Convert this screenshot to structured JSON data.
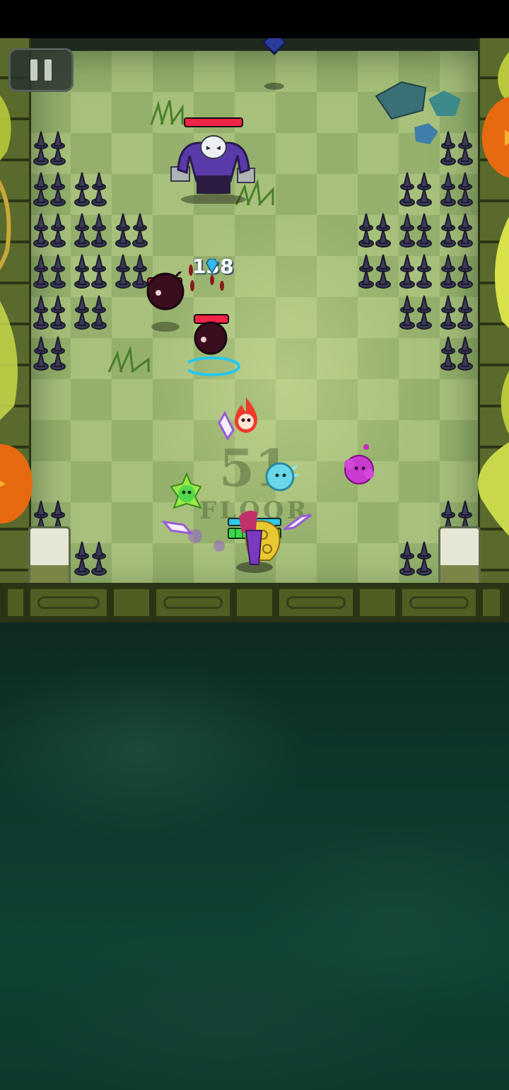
{
  "hud": {
    "pause_icon": "pause-icon"
  },
  "combat": {
    "damage_number": "138",
    "damage_icon": "diamond-gem-icon"
  },
  "level": {
    "floor_number": "51",
    "floor_word": "FLOOR"
  },
  "boss": {
    "icon": "skull-brute-icon",
    "hp_fraction": 1.0
  },
  "enemies": [
    {
      "name": "bomb-enemy-left",
      "hp_fraction": 1.0
    },
    {
      "name": "bomb-enemy-center",
      "hp_fraction": 1.0
    }
  ],
  "player": {
    "shield_fraction": 1.0,
    "hp_fraction": 1.0
  },
  "pets": [
    "fire-spirit-icon",
    "green-sprite-icon",
    "ice-spirit-icon",
    "purple-slime-icon"
  ],
  "floor_progress": {
    "segments": 4,
    "markers": 3
  },
  "colors": {
    "hp_red": "#ef2547",
    "shield_cyan": "#2ec8e8",
    "player_green": "#3ad84a",
    "indicator_orange": "#d88a1c"
  }
}
